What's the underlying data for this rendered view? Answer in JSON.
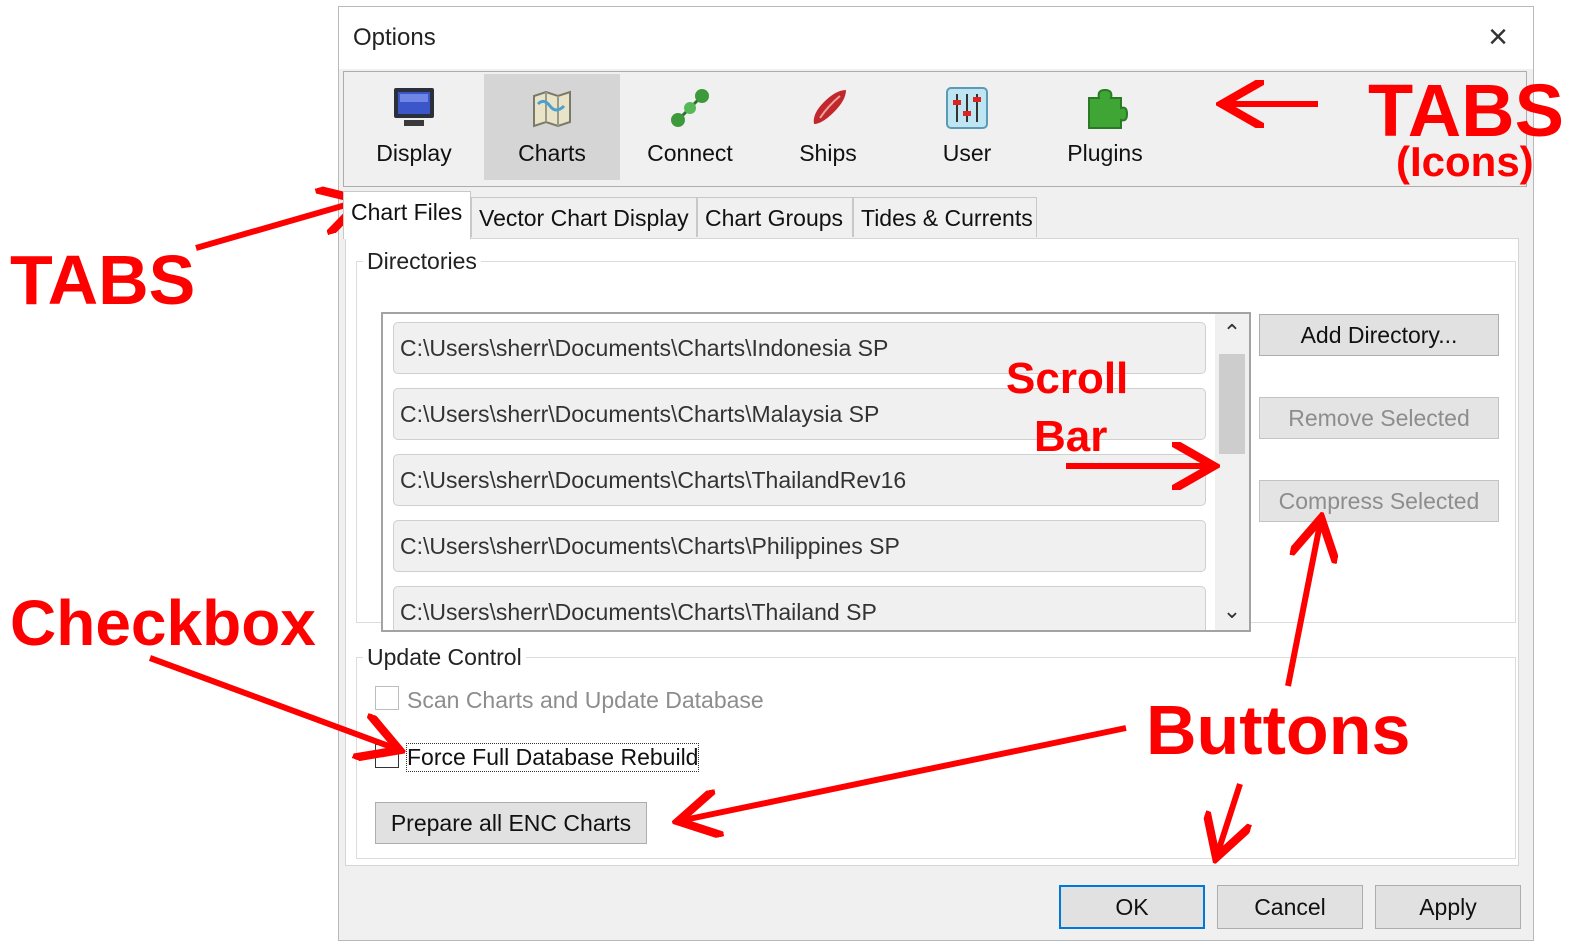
{
  "window": {
    "title": "Options",
    "close_glyph": "×"
  },
  "icon_tabs": [
    {
      "label": "Display",
      "icon": "monitor-icon"
    },
    {
      "label": "Charts",
      "icon": "chart-map-icon",
      "selected": true
    },
    {
      "label": "Connect",
      "icon": "connect-icon"
    },
    {
      "label": "Ships",
      "icon": "ship-icon"
    },
    {
      "label": "User",
      "icon": "sliders-icon"
    },
    {
      "label": "Plugins",
      "icon": "puzzle-icon"
    }
  ],
  "sub_tabs": [
    {
      "label": "Chart Files",
      "active": true
    },
    {
      "label": "Vector Chart Display"
    },
    {
      "label": "Chart Groups"
    },
    {
      "label": "Tides & Currents"
    }
  ],
  "directories": {
    "title": "Directories",
    "items": [
      "C:\\Users\\sherr\\Documents\\Charts\\Indonesia SP",
      "C:\\Users\\sherr\\Documents\\Charts\\Malaysia SP",
      "C:\\Users\\sherr\\Documents\\Charts\\ThailandRev16",
      "C:\\Users\\sherr\\Documents\\Charts\\Philippines SP",
      "C:\\Users\\sherr\\Documents\\Charts\\Thailand SP"
    ],
    "buttons": {
      "add": "Add Directory...",
      "remove": "Remove Selected",
      "compress": "Compress Selected"
    },
    "scroll_up": "⌃",
    "scroll_down": "⌄"
  },
  "update_control": {
    "title": "Update Control",
    "scan_label": "Scan Charts and Update Database",
    "scan_checked": false,
    "scan_enabled": false,
    "force_label": "Force Full Database Rebuild",
    "force_checked": false,
    "prepare_button": "Prepare all ENC Charts"
  },
  "footer": {
    "ok": "OK",
    "cancel": "Cancel",
    "apply": "Apply"
  },
  "annotations": {
    "tabs_icons_title": "TABS",
    "tabs_icons_sub": "(Icons)",
    "tabs_left": "TABS",
    "scroll_line1": "Scroll",
    "scroll_line2": "Bar",
    "checkbox": "Checkbox",
    "buttons": "Buttons"
  },
  "colors": {
    "annotation": "#ff0000",
    "default_button_border": "#0078d7",
    "selected_tab": "#d5d5d5"
  }
}
